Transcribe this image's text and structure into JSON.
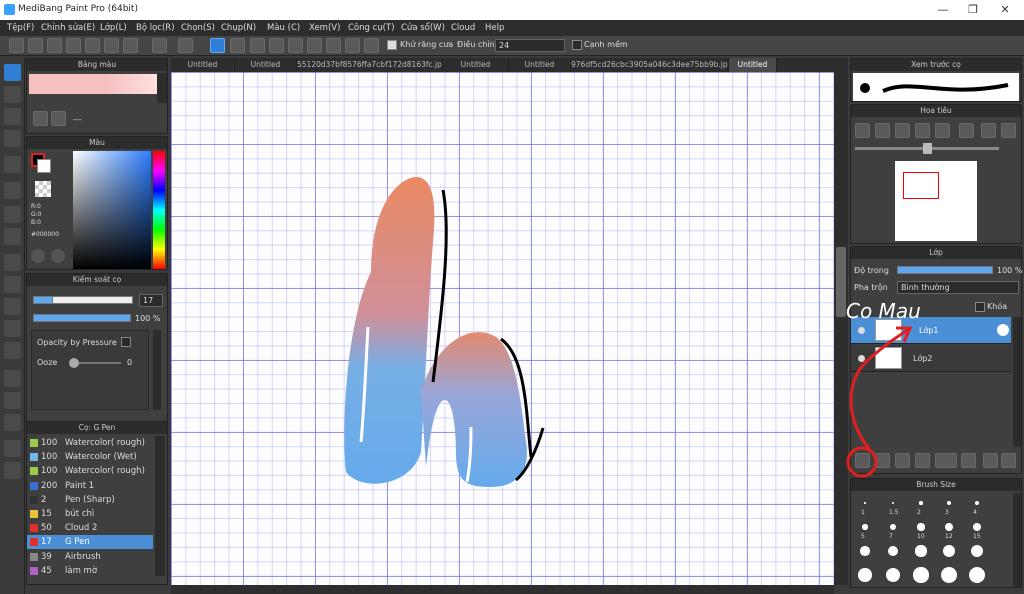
{
  "window": {
    "title": "MediBang Paint Pro (64bit)",
    "minimize": "—",
    "restore": "❐",
    "close": "✕"
  },
  "menu": [
    "Tệp(F)",
    "Chỉnh sửa(E)",
    "Lớp(L)",
    "Bộ lọc(R)",
    "Chọn(S)",
    "Chụp(N)",
    "Màu (C)",
    "Xem(V)",
    "Công cụ(T)",
    "Cửa sổ(W)",
    "Cloud",
    "Help"
  ],
  "toolbar": {
    "antialias_label": "Khử răng cưa",
    "adjust_label": "Điều chỉnh",
    "adjust_value": "24",
    "edge_label": "Cạnh mềm"
  },
  "tabs": [
    "Untitled",
    "Untitled",
    "55120d37bf8576ffa7cbf172d8163fc.jpg",
    "Untitled",
    "Untitled",
    "976df5cd26cbc3905a046c3dee75bb9b.jpg",
    "Untitled"
  ],
  "palette_panel": {
    "title": "Bảng màu",
    "dash": "---"
  },
  "color_panel": {
    "title": "Màu",
    "r": "R:0",
    "g": "G:0",
    "b": "B:0",
    "hex": "#000000"
  },
  "brush_control": {
    "title": "Kiểm soát cọ",
    "size_value": "17",
    "opacity_value": "100 %",
    "opacity_pressure_label": "Opacity by Pressure",
    "ooze_label": "Ooze",
    "ooze_value": "0"
  },
  "brush_list": {
    "title": "Cọ: G Pen",
    "items": [
      {
        "size": "100",
        "name": "Watercolor( rough)",
        "color": "#9acb4a"
      },
      {
        "size": "100",
        "name": "Watercolor (Wet)",
        "color": "#6fb8e8"
      },
      {
        "size": "100",
        "name": "Watercolor( rough)",
        "color": "#9acb4a"
      },
      {
        "size": "200",
        "name": "Paint 1",
        "color": "#3b6ccf"
      },
      {
        "size": "2",
        "name": "Pen (Sharp)",
        "color": "#333333"
      },
      {
        "size": "15",
        "name": "bút chì",
        "color": "#e8c33a"
      },
      {
        "size": "50",
        "name": "Cloud 2",
        "color": "#e03030"
      },
      {
        "size": "17",
        "name": "G Pen",
        "color": "#e03030"
      },
      {
        "size": "39",
        "name": "Airbrush",
        "color": "#888888"
      },
      {
        "size": "45",
        "name": "làm mờ",
        "color": "#b060c0"
      }
    ],
    "selected_index": 7
  },
  "preview_panel": {
    "title": "Xem trước cọ"
  },
  "navigator_panel": {
    "title": "Hoa tiêu"
  },
  "layer_panel": {
    "title": "Lớp",
    "opacity_label": "Độ trong",
    "opacity_value": "100 %",
    "blend_label": "Pha trộn",
    "blend_value": "Bình thường",
    "lock_label": "Khóa",
    "layers": [
      {
        "name": "Lớp1",
        "selected": true
      },
      {
        "name": "Lớp2",
        "selected": false
      }
    ]
  },
  "brush_size_panel": {
    "title": "Brush Size",
    "labels": [
      "1",
      "1.5",
      "2",
      "3",
      "4",
      "5",
      "7",
      "10",
      "12",
      "15"
    ]
  },
  "annotation": {
    "text": "Co Mau"
  },
  "colors": {
    "accent": "#2f7fd6",
    "annotation_red": "#e02020",
    "grid": "#5a5adc"
  }
}
